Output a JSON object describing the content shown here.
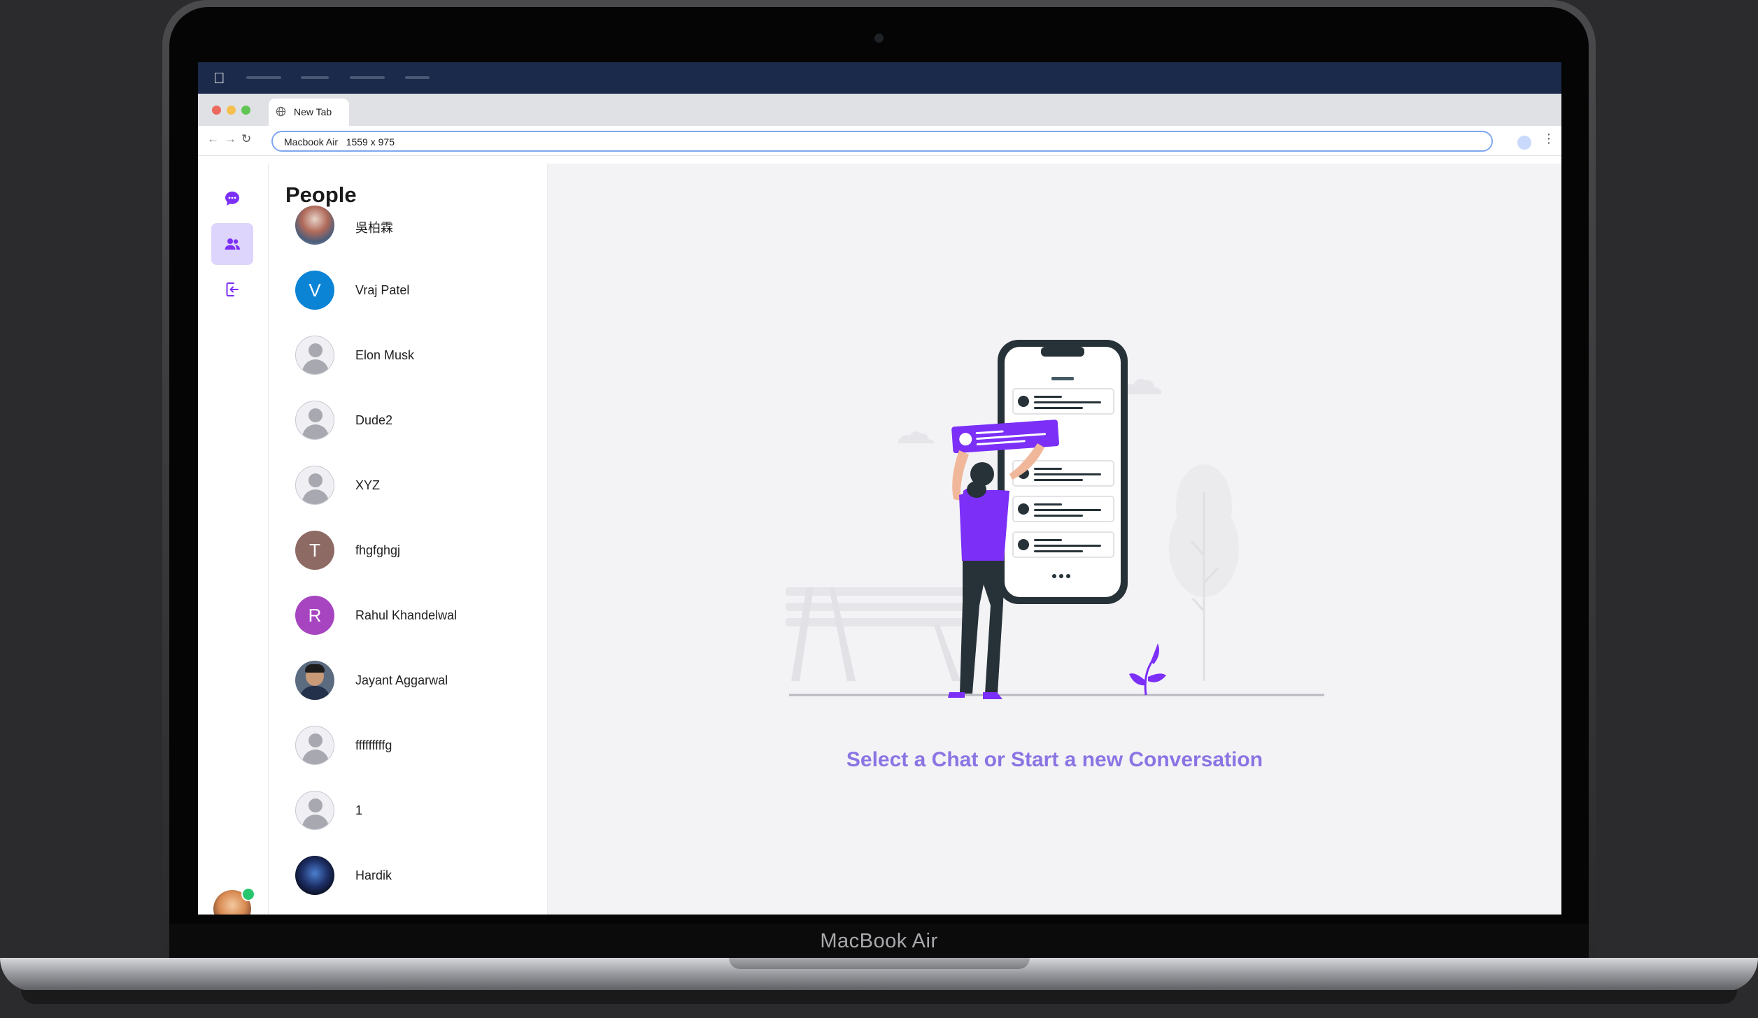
{
  "device": {
    "label": "MacBook Air"
  },
  "browser": {
    "tab_title": "New Tab",
    "address": "Macbook Air   1559 x 975"
  },
  "app": {
    "rail": {
      "items": [
        {
          "name": "chats",
          "icon": "chat-bubble-icon",
          "active": false
        },
        {
          "name": "people",
          "icon": "people-icon",
          "active": true
        },
        {
          "name": "logout",
          "icon": "logout-icon",
          "active": false
        }
      ],
      "user_status": "online"
    },
    "people": {
      "title": "People",
      "list": [
        {
          "name": "吳柏霖",
          "avatar": "photo"
        },
        {
          "name": "Vraj Patel",
          "avatar": "letter",
          "initial": "V",
          "color": "#0b84d6"
        },
        {
          "name": "Elon Musk",
          "avatar": "default"
        },
        {
          "name": "Dude2",
          "avatar": "default"
        },
        {
          "name": "XYZ",
          "avatar": "default"
        },
        {
          "name": "fhgfghgj",
          "avatar": "letter",
          "initial": "T",
          "color": "#8d6b64"
        },
        {
          "name": "Rahul Khandelwal",
          "avatar": "letter",
          "initial": "R",
          "color": "#a745c1"
        },
        {
          "name": "Jayant Aggarwal",
          "avatar": "photo"
        },
        {
          "name": "fffffffffg",
          "avatar": "default"
        },
        {
          "name": "1",
          "avatar": "default"
        },
        {
          "name": "Hardik",
          "avatar": "photo"
        }
      ]
    },
    "main": {
      "empty_message": "Select a Chat or Start a new Conversation"
    },
    "colors": {
      "accent": "#7b2ff7",
      "accent_light": "#ddd5fb",
      "cta_text": "#8b74e3"
    }
  }
}
